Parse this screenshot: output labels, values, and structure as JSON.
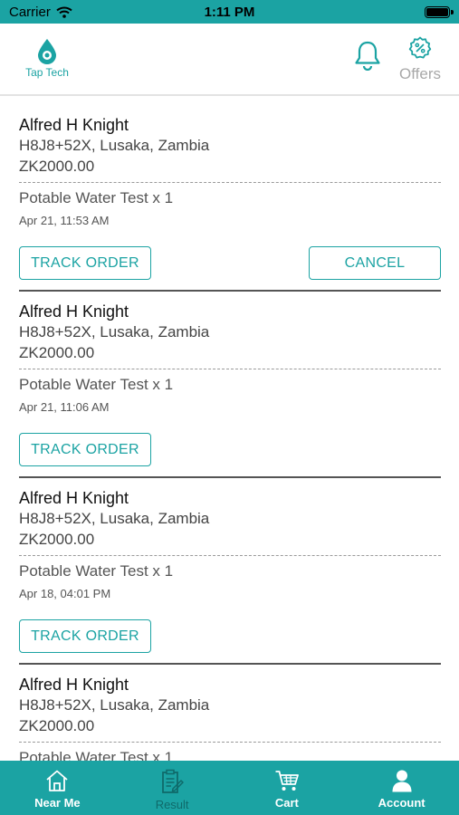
{
  "status_bar": {
    "carrier": "Carrier",
    "time": "1:11 PM"
  },
  "header": {
    "logo_text": "Tap Tech",
    "offers_label": "Offers"
  },
  "orders": [
    {
      "name": "Alfred H Knight",
      "address": "H8J8+52X, Lusaka, Zambia",
      "price": "ZK2000.00",
      "item": "Potable Water Test x 1",
      "date": "Apr 21, 11:53 AM",
      "track_label": "TRACK ORDER",
      "cancel_label": "CANCEL"
    },
    {
      "name": "Alfred H Knight",
      "address": "H8J8+52X, Lusaka, Zambia",
      "price": "ZK2000.00",
      "item": "Potable Water Test x 1",
      "date": "Apr 21, 11:06 AM",
      "track_label": "TRACK ORDER"
    },
    {
      "name": "Alfred H Knight",
      "address": "H8J8+52X, Lusaka, Zambia",
      "price": "ZK2000.00",
      "item": "Potable Water Test x 1",
      "date": "Apr 18, 04:01 PM",
      "track_label": "TRACK ORDER"
    },
    {
      "name": "Alfred H Knight",
      "address": "H8J8+52X, Lusaka, Zambia",
      "price": "ZK2000.00",
      "item": "Potable Water Test x 1"
    }
  ],
  "tabs": [
    {
      "label": "Near Me",
      "icon": "home-icon"
    },
    {
      "label": "Result",
      "icon": "clipboard-icon",
      "active": true
    },
    {
      "label": "Cart",
      "icon": "cart-icon"
    },
    {
      "label": "Account",
      "icon": "user-icon"
    }
  ],
  "colors": {
    "brand": "#1ba3a3",
    "active_tab": "#0f6a6a"
  }
}
